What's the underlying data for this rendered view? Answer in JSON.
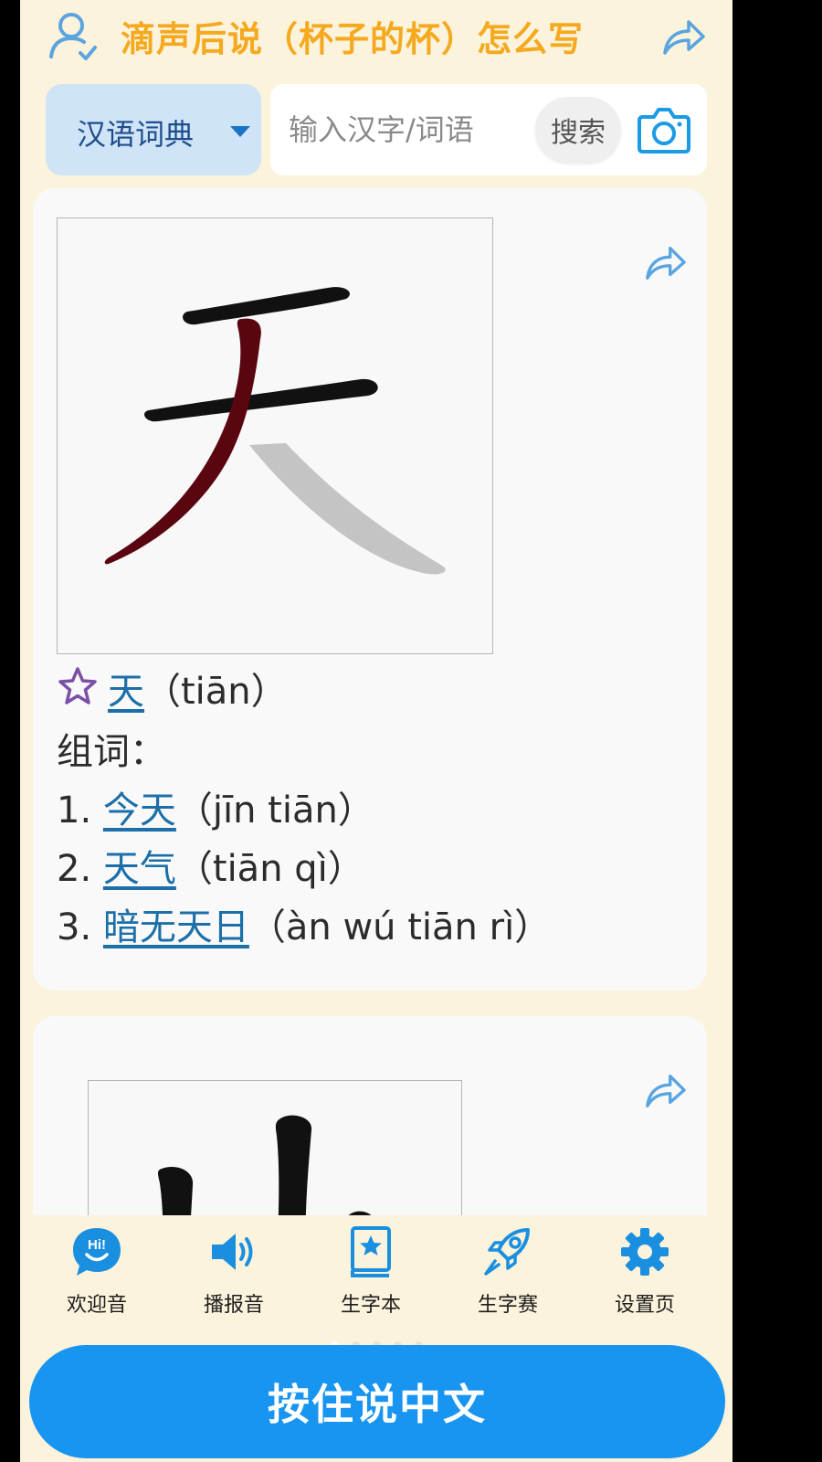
{
  "header": {
    "title": "滴声后说（杯子的杯）怎么写"
  },
  "search": {
    "dictionary_label": "汉语词典",
    "placeholder": "输入汉字/词语",
    "button_label": "搜索"
  },
  "entry": {
    "character": "天",
    "pinyin": "（tiān）",
    "words_label": "组词：",
    "words": [
      {
        "index": "1.",
        "word": "今天",
        "pinyin": "（jīn tiān）"
      },
      {
        "index": "2.",
        "word": "天气",
        "pinyin": "（tiān qì）"
      },
      {
        "index": "3.",
        "word": "暗无天日",
        "pinyin": "（àn wú tiān rì）"
      }
    ]
  },
  "nav": {
    "items": [
      {
        "label": "欢迎音",
        "icon": "hi-chat-icon"
      },
      {
        "label": "播报音",
        "icon": "speaker-icon"
      },
      {
        "label": "生字本",
        "icon": "star-book-icon"
      },
      {
        "label": "生字赛",
        "icon": "rocket-icon"
      },
      {
        "label": "设置页",
        "icon": "gear-icon"
      }
    ],
    "page_count": 5,
    "active_page": 1
  },
  "talk_button": "按住说中文",
  "colors": {
    "background": "#fcf3dc",
    "title": "#f4a91f",
    "accent": "#1895f0",
    "link": "#1c6fa8",
    "active_stroke": "#5a0610"
  }
}
